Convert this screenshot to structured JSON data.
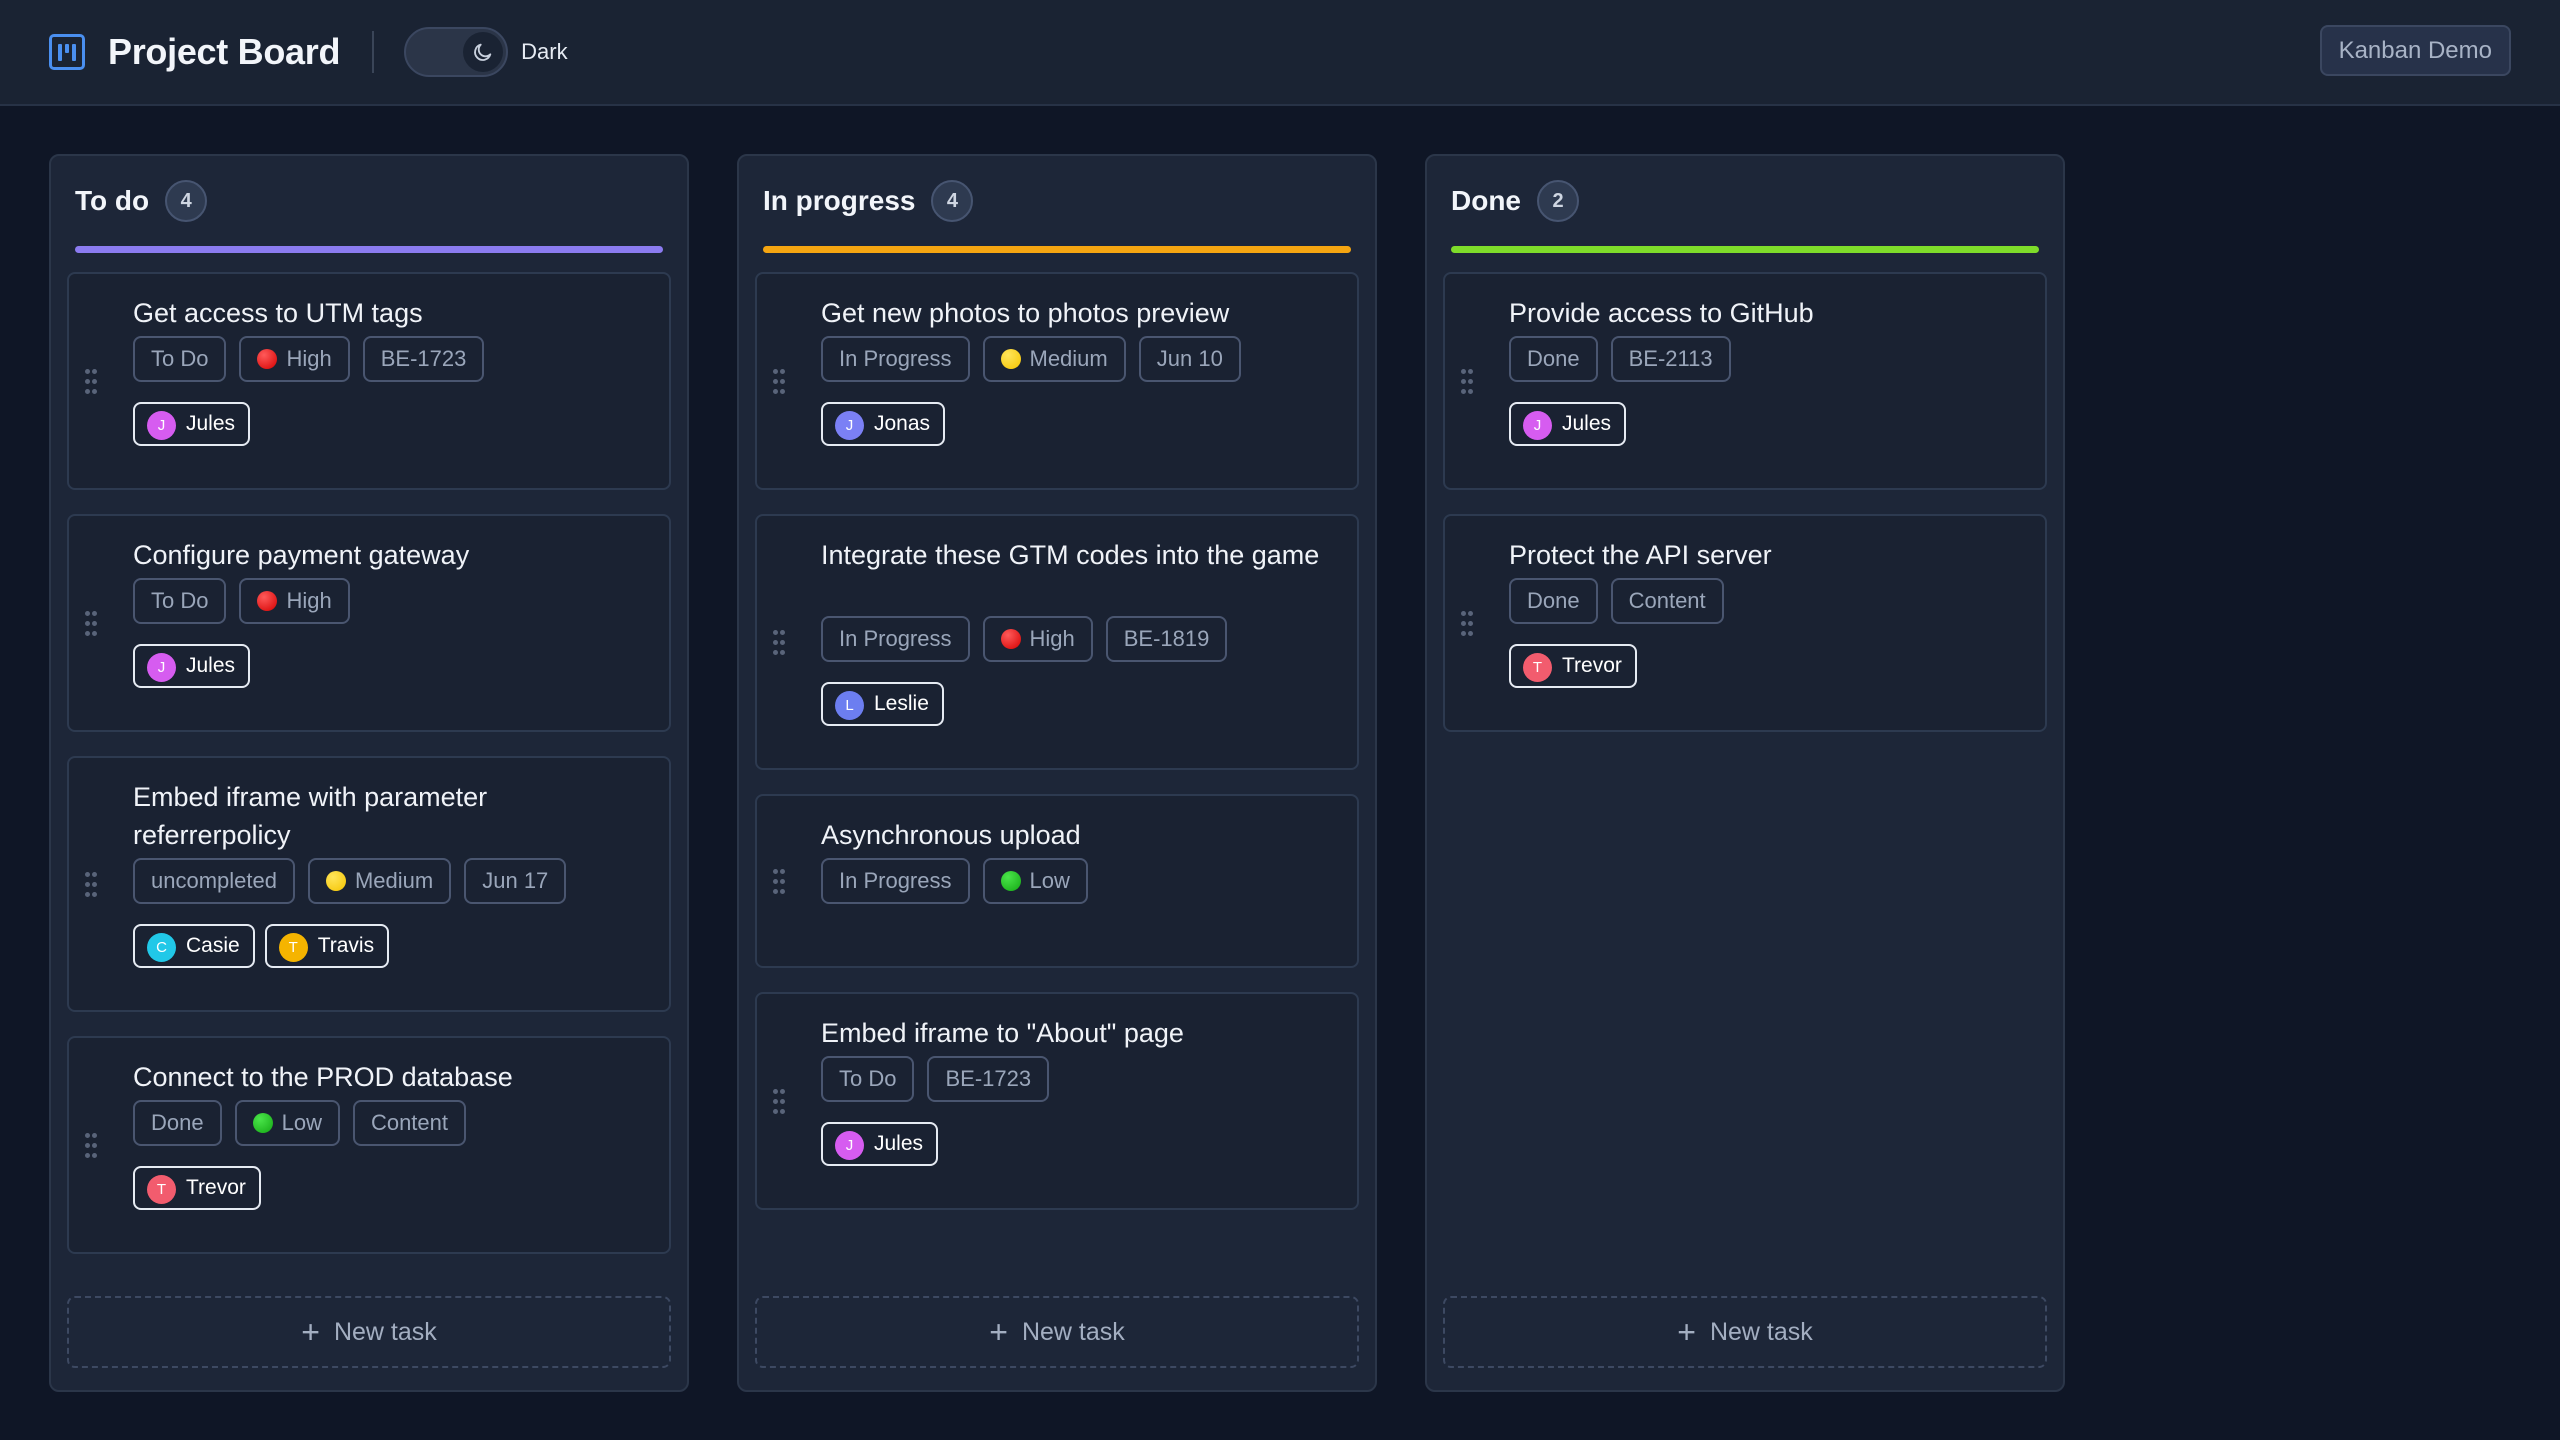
{
  "header": {
    "title": "Project Board",
    "theme_label": "Dark",
    "demo_button": "Kanban Demo"
  },
  "colors": {
    "todo": "#8b7bf0",
    "in_progress": "#f5a511",
    "done": "#7edc2a",
    "avatar_jules": "#d65cf0",
    "avatar_jonas": "#7b80f5",
    "avatar_leslie": "#6c7ef0",
    "avatar_casie": "#21c8e8",
    "avatar_travis": "#f5b400",
    "avatar_trevor": "#f25c6e"
  },
  "new_task_label": "New task",
  "columns": [
    {
      "title": "To do",
      "count": "4",
      "cards": [
        {
          "title": "Get access to UTM tags",
          "tags": [
            "To Do",
            "High",
            "BE-1723"
          ],
          "users": [
            "Jules"
          ]
        },
        {
          "title": "Configure payment gateway",
          "tags": [
            "To Do",
            "High"
          ],
          "users": [
            "Jules"
          ]
        },
        {
          "title": "Embed iframe with parameter referrerpolicy",
          "tags": [
            "uncompleted",
            "Medium",
            "Jun 17"
          ],
          "users": [
            "Casie",
            "Travis"
          ]
        },
        {
          "title": "Connect to the PROD database",
          "tags": [
            "Done",
            "Low",
            "Content"
          ],
          "users": [
            "Trevor"
          ]
        }
      ]
    },
    {
      "title": "In progress",
      "count": "4",
      "cards": [
        {
          "title": "Get new photos to photos preview",
          "tags": [
            "In Progress",
            "Medium",
            "Jun 10"
          ],
          "users": [
            "Jonas"
          ]
        },
        {
          "title": "Integrate these GTM codes into the game",
          "tags": [
            "In Progress",
            "High",
            "BE-1819"
          ],
          "users": [
            "Leslie"
          ]
        },
        {
          "title": "Asynchronous upload",
          "tags": [
            "In Progress",
            "Low"
          ],
          "users": []
        },
        {
          "title": "Embed iframe to \"About\" page",
          "tags": [
            "To Do",
            "BE-1723"
          ],
          "users": [
            "Jules"
          ]
        }
      ]
    },
    {
      "title": "Done",
      "count": "2",
      "cards": [
        {
          "title": "Provide access to GitHub",
          "tags": [
            "Done",
            "BE-2113"
          ],
          "users": [
            "Jules"
          ]
        },
        {
          "title": "Protect the API server",
          "tags": [
            "Done",
            "Content"
          ],
          "users": [
            "Trevor"
          ]
        }
      ]
    }
  ],
  "avatar_initials": {
    "Jules": "J",
    "Jonas": "J",
    "Leslie": "L",
    "Casie": "C",
    "Travis": "T",
    "Trevor": "T"
  }
}
